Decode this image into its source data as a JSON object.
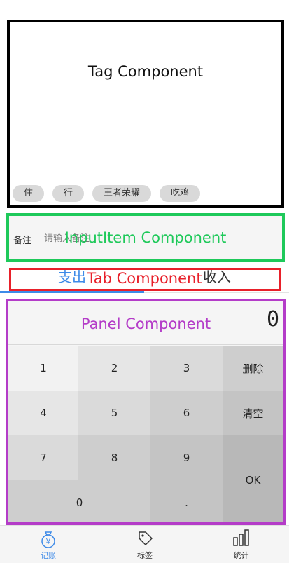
{
  "tags_section": {
    "title": "Tag Component",
    "tags": [
      {
        "label": "住"
      },
      {
        "label": "行"
      },
      {
        "label": "王者荣耀"
      },
      {
        "label": "吃鸡"
      }
    ],
    "border_color": "#000000"
  },
  "note_section": {
    "title": "InputItem Component",
    "label": "备注",
    "placeholder": "请输入备注",
    "value": "",
    "border_color": "#1ec95a"
  },
  "tab_section": {
    "title": "Tab Component",
    "tabs": [
      {
        "label": "支出",
        "selected": true
      },
      {
        "label": "收入",
        "selected": false
      }
    ],
    "border_color": "#e8202a",
    "active_color": "#3d8ae8"
  },
  "panel_section": {
    "title": "Panel Component",
    "amount": "0",
    "border_color": "#b43cc8",
    "keys": {
      "k1": "1",
      "k2": "2",
      "k3": "3",
      "delete": "删除",
      "k4": "4",
      "k5": "5",
      "k6": "6",
      "clear": "清空",
      "k7": "7",
      "k8": "8",
      "k9": "9",
      "ok": "OK",
      "k0": "0",
      "dot": "."
    }
  },
  "bottom_nav": {
    "items": [
      {
        "label": "记账",
        "icon": "money-bag-icon",
        "active": true
      },
      {
        "label": "标签",
        "icon": "tag-icon",
        "active": false
      },
      {
        "label": "统计",
        "icon": "bar-chart-icon",
        "active": false
      }
    ],
    "active_color": "#3d8ae8",
    "inactive_color": "#333333"
  }
}
